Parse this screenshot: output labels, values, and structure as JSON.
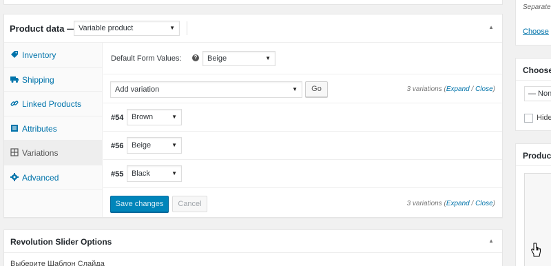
{
  "product_data": {
    "title": "Product data —",
    "product_type": "Variable product",
    "tabs": [
      {
        "label": "Inventory",
        "icon": "tag-icon"
      },
      {
        "label": "Shipping",
        "icon": "truck-icon"
      },
      {
        "label": "Linked Products",
        "icon": "link-icon"
      },
      {
        "label": "Attributes",
        "icon": "list-icon"
      },
      {
        "label": "Variations",
        "icon": "grid-icon",
        "active": true
      },
      {
        "label": "Advanced",
        "icon": "gear-icon"
      }
    ],
    "default_form_values_label": "Default Form Values:",
    "default_form_value": "Beige",
    "add_variation_option": "Add variation",
    "go_label": "Go",
    "variations_count_text": "3 variations",
    "expand_label": "Expand",
    "slash": "/",
    "close_label": "Close",
    "variations": [
      {
        "id": "#54",
        "color": "Brown"
      },
      {
        "id": "#56",
        "color": "Beige"
      },
      {
        "id": "#55",
        "color": "Black"
      }
    ],
    "save_label": "Save changes",
    "cancel_label": "Cancel"
  },
  "revolution_slider": {
    "title": "Revolution Slider Options",
    "body_text": "Выберите Шаблон Слайда"
  },
  "sidebar": {
    "separate_text": "Separate",
    "choose_link": "Choose",
    "choose_title": "Choose",
    "none_option": "— None",
    "hide_label": "Hide",
    "product_title": "Product"
  },
  "colors": {
    "link": "#0073aa",
    "primary_button": "#0085ba",
    "background": "#f1f1f1"
  }
}
